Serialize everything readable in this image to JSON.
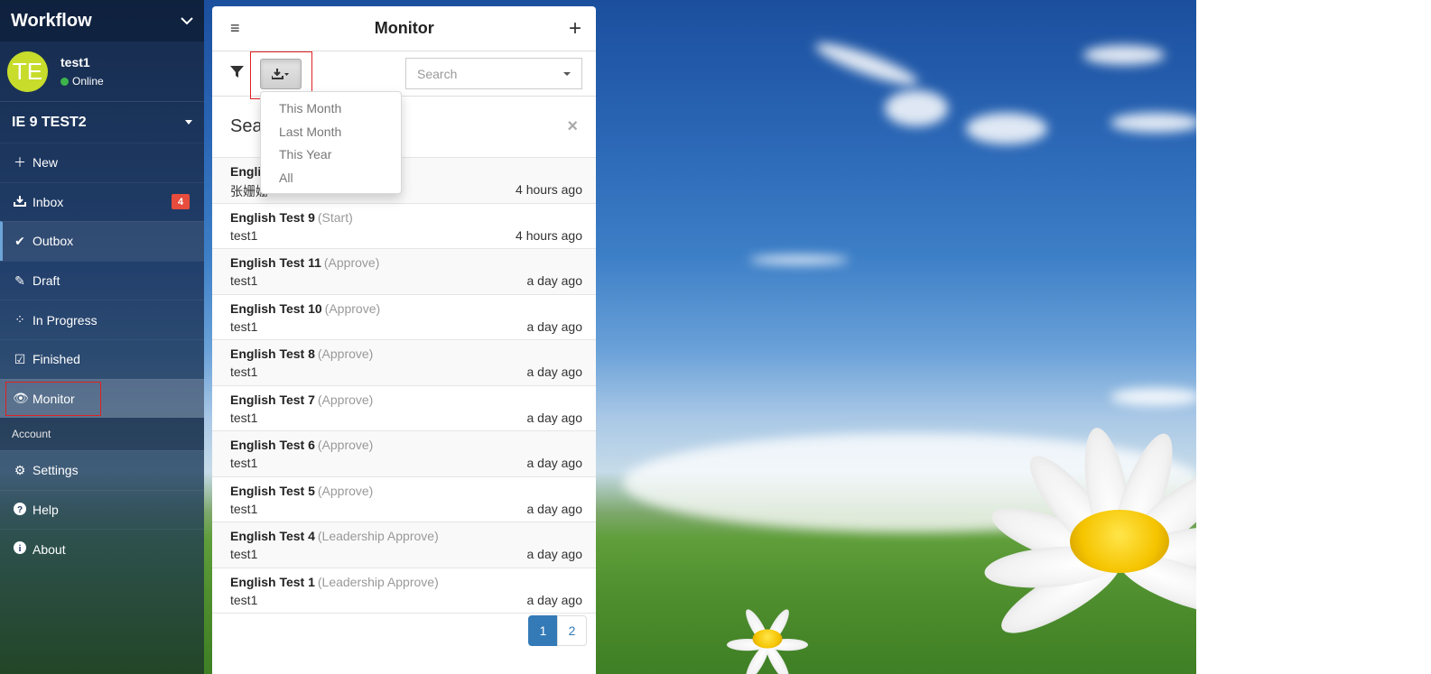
{
  "sidebar": {
    "title": "Workflow",
    "user": {
      "initials": "TE",
      "name": "test1",
      "status": "Online"
    },
    "company": "IE 9 TEST2",
    "nav": [
      {
        "label": "New",
        "icon": "plus-icon"
      },
      {
        "label": "Inbox",
        "icon": "inbox-icon",
        "badge": "4"
      },
      {
        "label": "Outbox",
        "icon": "check-double-icon"
      },
      {
        "label": "Draft",
        "icon": "edit-icon"
      },
      {
        "label": "In Progress",
        "icon": "spinner-icon"
      },
      {
        "label": "Finished",
        "icon": "checkbox-icon"
      },
      {
        "label": "Monitor",
        "icon": "eye-icon"
      }
    ],
    "account_section": "Account",
    "account_nav": [
      {
        "label": "Settings",
        "icon": "gear-icon"
      },
      {
        "label": "Help",
        "icon": "question-icon"
      },
      {
        "label": "About",
        "icon": "info-icon"
      }
    ]
  },
  "panel": {
    "title": "Monitor",
    "search": {
      "placeholder": "Search"
    },
    "search_result_label": "Sea",
    "items": [
      {
        "title": "Englis",
        "step": "",
        "user": "张姗姗",
        "time": "4 hours ago"
      },
      {
        "title": "English Test 9",
        "step": "(Start)",
        "user": "test1",
        "time": "4 hours ago"
      },
      {
        "title": "English Test 11",
        "step": "(Approve)",
        "user": "test1",
        "time": "a day ago"
      },
      {
        "title": "English Test 10",
        "step": "(Approve)",
        "user": "test1",
        "time": "a day ago"
      },
      {
        "title": "English Test 8",
        "step": "(Approve)",
        "user": "test1",
        "time": "a day ago"
      },
      {
        "title": "English Test 7",
        "step": "(Approve)",
        "user": "test1",
        "time": "a day ago"
      },
      {
        "title": "English Test 6",
        "step": "(Approve)",
        "user": "test1",
        "time": "a day ago"
      },
      {
        "title": "English Test 5",
        "step": "(Approve)",
        "user": "test1",
        "time": "a day ago"
      },
      {
        "title": "English Test 4",
        "step": "(Leadership Approve)",
        "user": "test1",
        "time": "a day ago"
      },
      {
        "title": "English Test 1",
        "step": "(Leadership Approve)",
        "user": "test1",
        "time": "a day ago"
      }
    ],
    "pagination": [
      "1",
      "2"
    ]
  },
  "export_menu": [
    "This Month",
    "Last Month",
    "This Year",
    "All"
  ],
  "colors": {
    "accent": "#337ab7",
    "badge": "#e74c3c",
    "avatar": "#c7dc2b",
    "highlight_box": "#e02020"
  }
}
